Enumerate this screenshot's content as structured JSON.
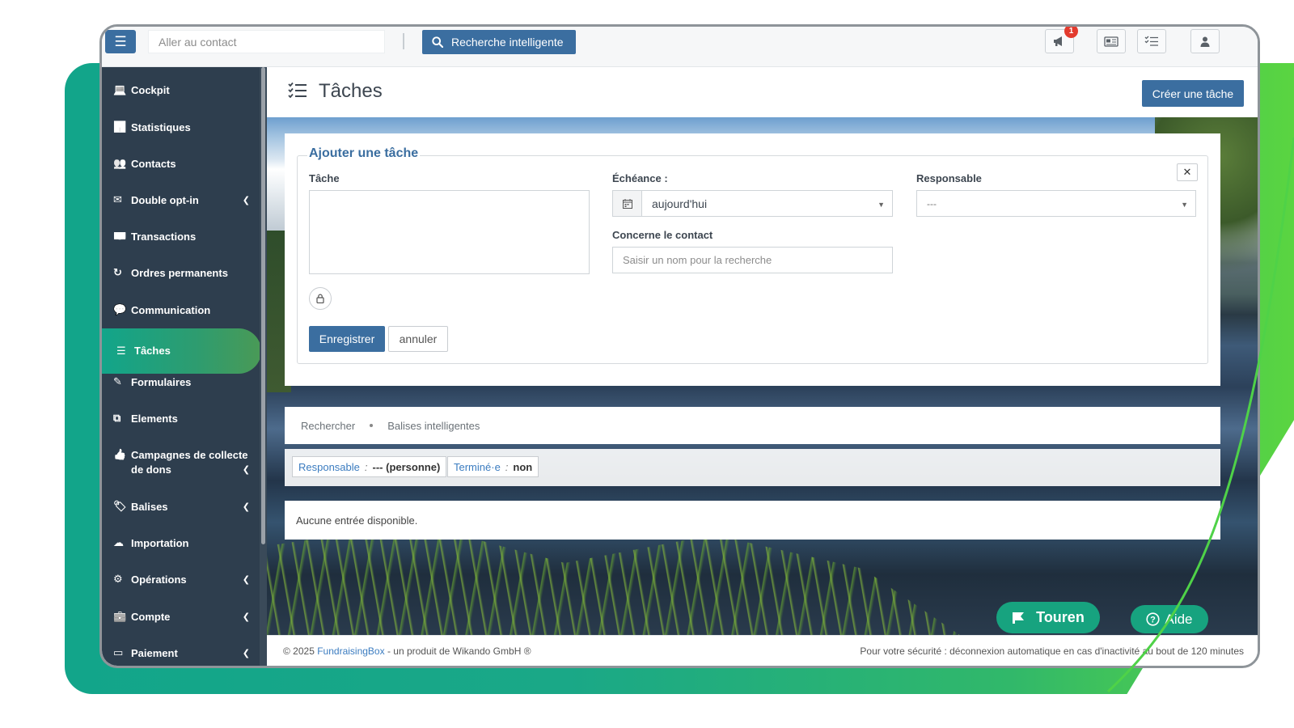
{
  "topbar": {
    "contact_placeholder": "Aller au contact",
    "smart_search_label": "Recherche intelligente",
    "notification_count": "1"
  },
  "sidebar": {
    "items": [
      {
        "label": "Cockpit",
        "icon": "laptop-icon",
        "has_chevron": false
      },
      {
        "label": "Statistiques",
        "icon": "chart-icon",
        "has_chevron": false
      },
      {
        "label": "Contacts",
        "icon": "users-icon",
        "has_chevron": false
      },
      {
        "label": "Double opt-in",
        "icon": "envelope-icon",
        "has_chevron": true
      },
      {
        "label": "Transactions",
        "icon": "money-icon",
        "has_chevron": false
      },
      {
        "label": "Ordres permanents",
        "icon": "recurring-icon",
        "has_chevron": false
      },
      {
        "label": "Communication",
        "icon": "chat-icon",
        "has_chevron": false
      },
      {
        "label": "Tâches",
        "icon": "tasks-icon",
        "has_chevron": false,
        "active": true
      },
      {
        "label": "Formulaires",
        "icon": "edit-icon",
        "has_chevron": false
      },
      {
        "label": "Elements",
        "icon": "puzzle-icon",
        "has_chevron": false
      },
      {
        "label": "Campagnes de collecte de dons",
        "icon": "thumbs-up-icon",
        "has_chevron": true
      },
      {
        "label": "Balises",
        "icon": "tag-icon",
        "has_chevron": true
      },
      {
        "label": "Importation",
        "icon": "cloud-upload-icon",
        "has_chevron": false
      },
      {
        "label": "Opérations",
        "icon": "robot-icon",
        "has_chevron": true
      },
      {
        "label": "Compte",
        "icon": "briefcase-icon",
        "has_chevron": true
      },
      {
        "label": "Paiement",
        "icon": "card-icon",
        "has_chevron": true
      }
    ]
  },
  "page": {
    "title": "Tâches",
    "create_button": "Créer une tâche"
  },
  "form": {
    "legend": "Ajouter une tâche",
    "task_label": "Tâche",
    "due_label": "Échéance :",
    "due_value": "aujourd'hui",
    "responsible_label": "Responsable",
    "responsible_value": "---",
    "contact_label": "Concerne le contact",
    "contact_placeholder": "Saisir un nom pour la recherche",
    "save_button": "Enregistrer",
    "cancel_button": "annuler"
  },
  "search_tabs": {
    "search": "Rechercher",
    "smart_tags": "Balises intelligentes"
  },
  "filters": [
    {
      "key": "Responsable",
      "separator": ":",
      "value": "--- (personne)"
    },
    {
      "key": "Terminé·e",
      "separator": ":",
      "value": "non"
    }
  ],
  "results": {
    "empty_text": "Aucune entrée disponible."
  },
  "floating": {
    "touren_label": "Touren",
    "aide_label": "Aide"
  },
  "footer": {
    "copyright_prefix": "© 2025 ",
    "brand_link": "FundraisingBox",
    "copyright_suffix": " - un produit de Wikando GmbH ®",
    "security_note": "Pour votre sécurité : déconnexion automatique en cas d'inactivité au bout de  120 minutes"
  },
  "colors": {
    "primary": "#3b6ea0",
    "sidebar_bg": "#2e3e4e",
    "accent_green": "#17a37f",
    "badge_red": "#e33b2e"
  }
}
